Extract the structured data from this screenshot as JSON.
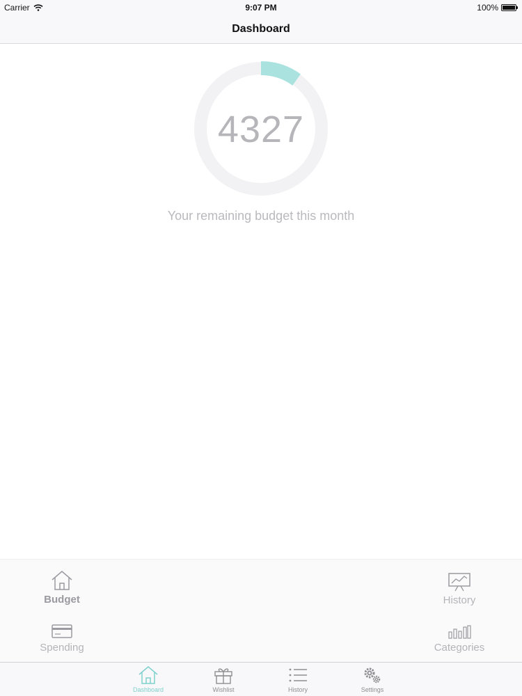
{
  "status_bar": {
    "carrier": "Carrier",
    "time": "9:07 PM",
    "battery": "100%"
  },
  "nav": {
    "title": "Dashboard"
  },
  "budget": {
    "remaining": "4327",
    "caption": "Your remaining budget this month",
    "progress_fraction": 0.1
  },
  "quick_actions": {
    "budget": "Budget",
    "spending": "Spending",
    "history": "History",
    "categories": "Categories"
  },
  "tabs": [
    {
      "label": "Dashboard",
      "icon": "house-icon",
      "active": true
    },
    {
      "label": "Wishlist",
      "icon": "gift-icon",
      "active": false
    },
    {
      "label": "History",
      "icon": "list-icon",
      "active": false
    },
    {
      "label": "Settings",
      "icon": "gears-icon",
      "active": false
    }
  ],
  "colors": {
    "accent": "#7fd1cd",
    "ring_track": "#f2f2f4",
    "muted_text": "#b5b5ba"
  }
}
